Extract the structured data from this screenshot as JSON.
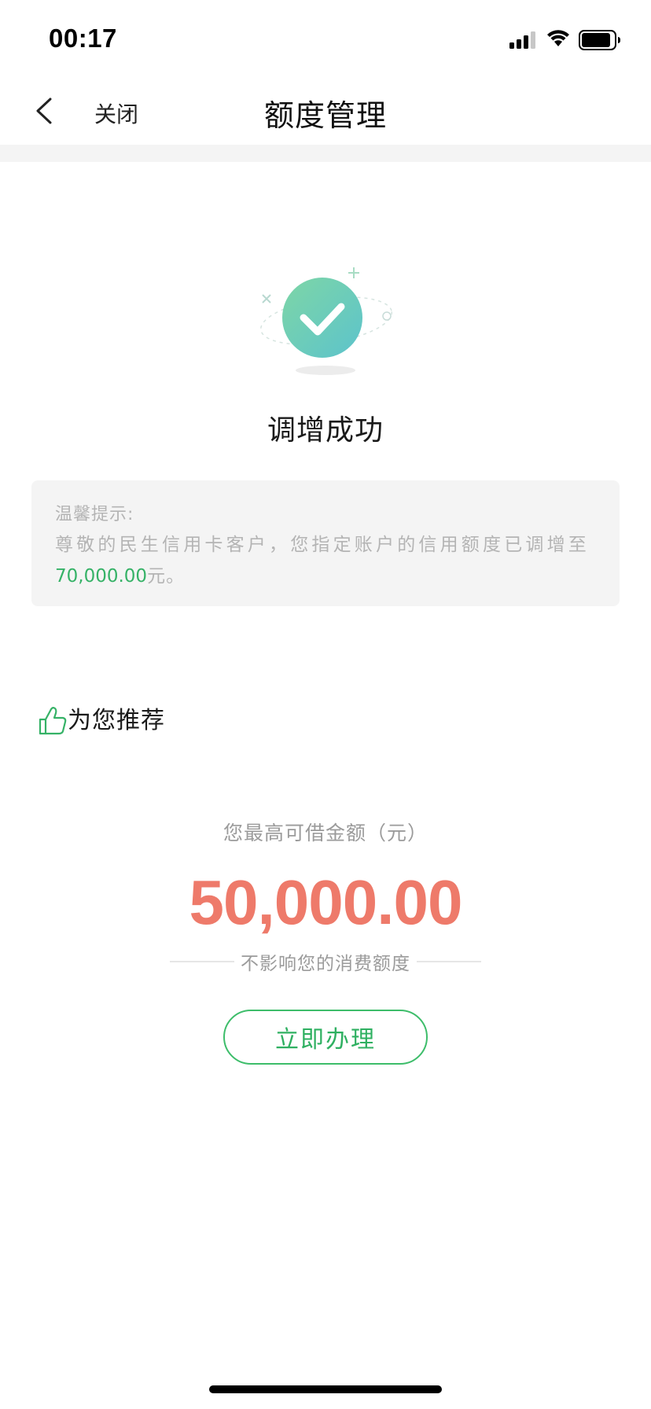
{
  "status_bar": {
    "time": "00:17",
    "icons": [
      "cellular-signal-icon",
      "wifi-icon",
      "battery-icon"
    ]
  },
  "nav": {
    "back_icon": "chevron-left-icon",
    "close_label": "关闭",
    "title": "额度管理"
  },
  "result": {
    "icon": "success-check-icon",
    "title": "调增成功"
  },
  "tip": {
    "heading": "温馨提示:",
    "body_prefix": "尊敬的民生信用卡客户，您指定账户的信用额度已调增至",
    "amount": "70,000.00",
    "body_suffix": "元。"
  },
  "recommend": {
    "icon": "thumbs-up-icon",
    "title": "为您推荐"
  },
  "loan": {
    "label": "您最高可借金额（元）",
    "amount": "50,000.00",
    "note": "不影响您的消费额度",
    "button_label": "立即办理"
  },
  "colors": {
    "brand_green": "#36b267",
    "amount_orange": "#ee7a6a",
    "success_gradient_start": "#7ed6a6",
    "success_gradient_end": "#5cc3cc",
    "tip_background": "#f4f4f4"
  }
}
